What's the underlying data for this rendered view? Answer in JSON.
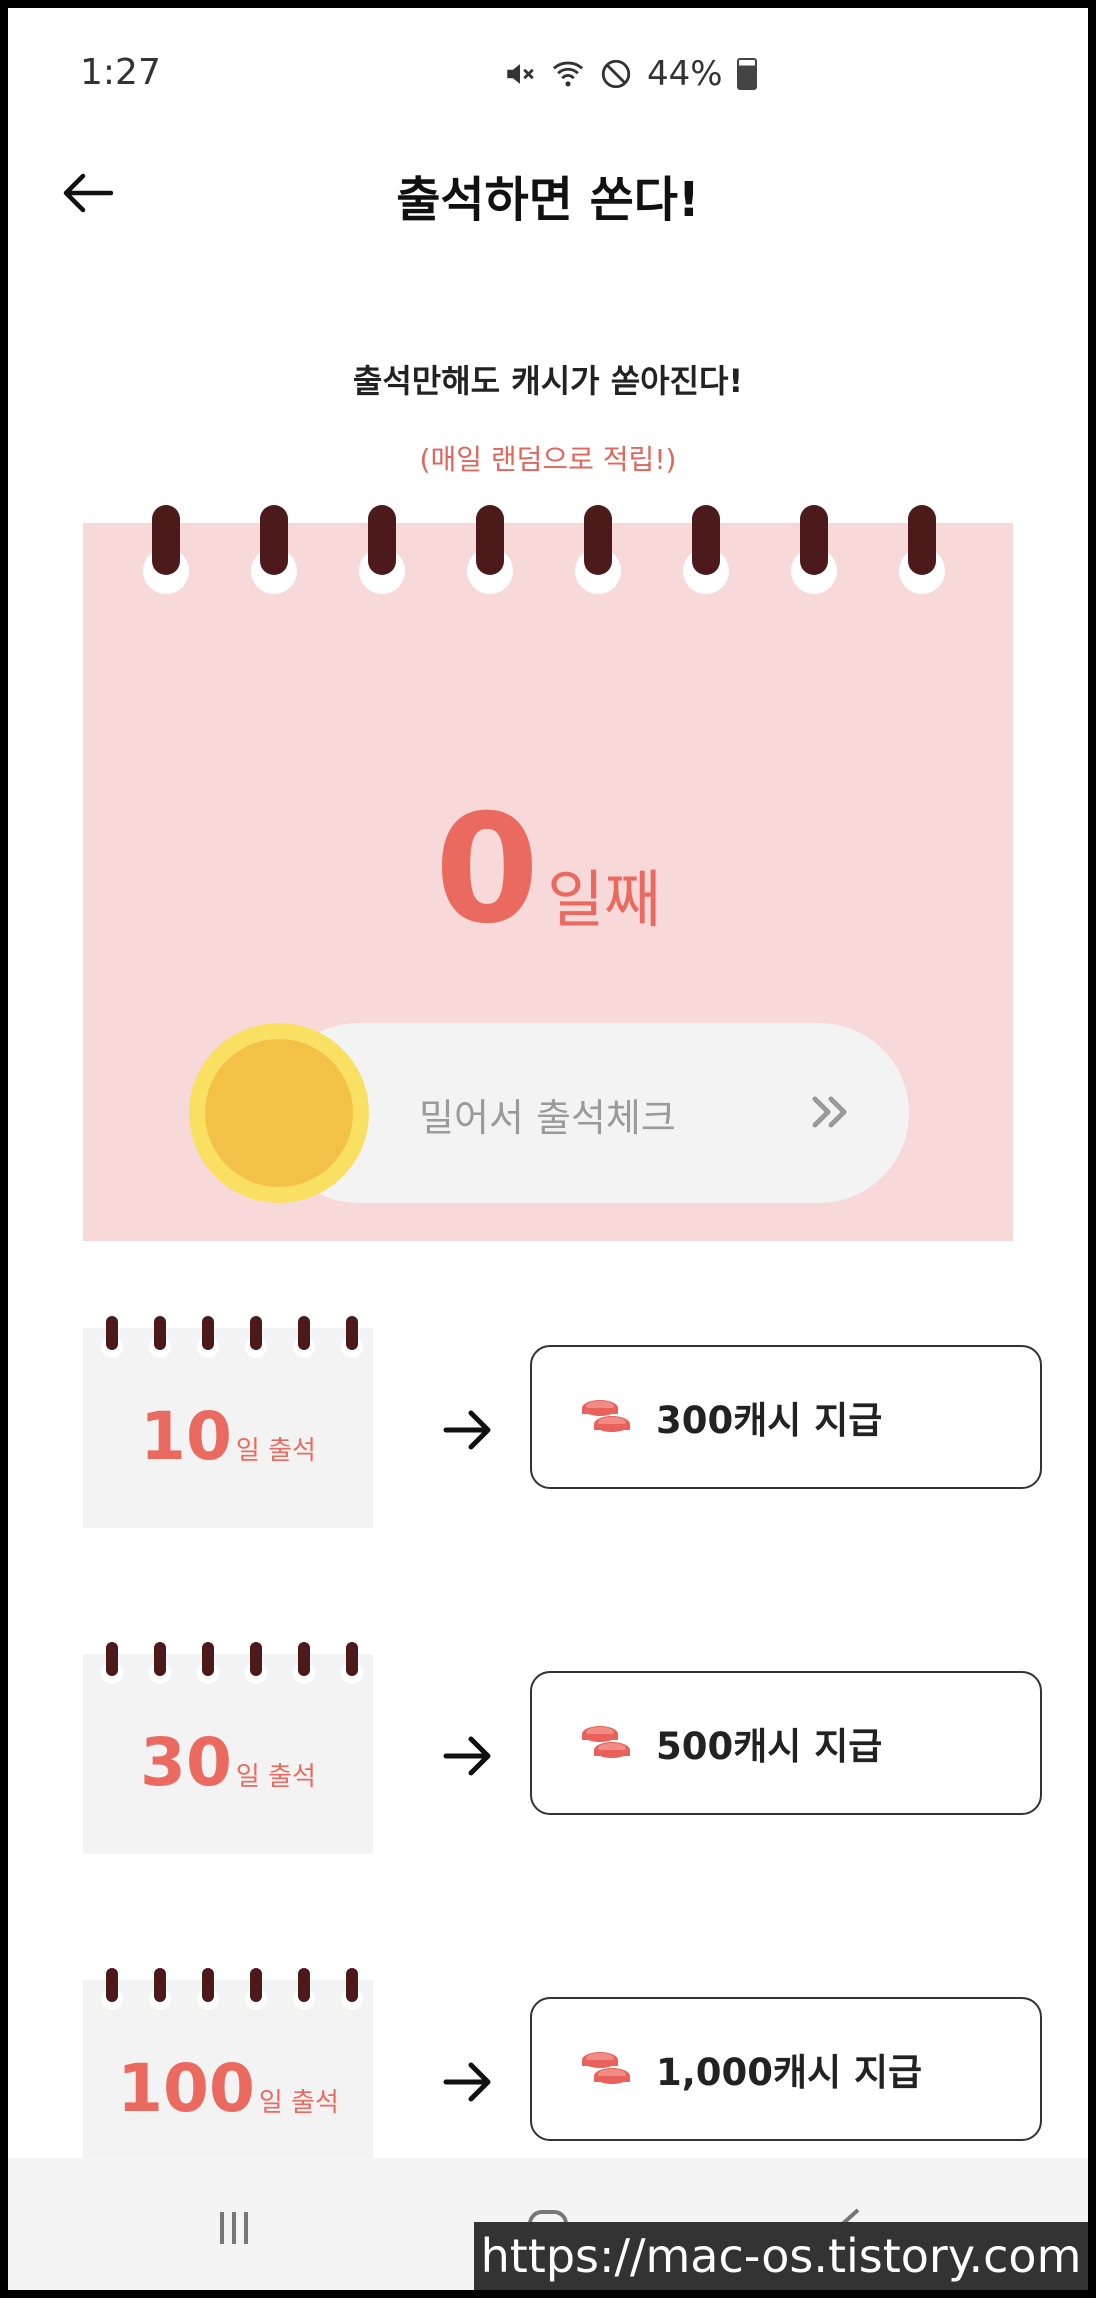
{
  "status_bar": {
    "time": "1:27",
    "battery_text": "44%"
  },
  "header": {
    "title": "출석하면 쏜다!"
  },
  "intro": {
    "subtitle": "출석만해도 캐시가 쏟아진다!",
    "note": "(매일 랜덤으로 적립!)"
  },
  "calendar": {
    "day_number": "0",
    "day_unit": "일째",
    "slider_label": "밀어서 출석체크"
  },
  "rewards": [
    {
      "days": "10",
      "unit": "일 출석",
      "reward": "300캐시 지급"
    },
    {
      "days": "30",
      "unit": "일 출석",
      "reward": "500캐시 지급"
    },
    {
      "days": "100",
      "unit": "일 출석",
      "reward": "1,000캐시 지급"
    }
  ],
  "watermark": "https://mac-os.tistory.com",
  "colors": {
    "accent": "#ea6a60",
    "calendar_bg": "#f8d9d9",
    "ring": "#4c1a1a",
    "knob": "#f3c146"
  }
}
